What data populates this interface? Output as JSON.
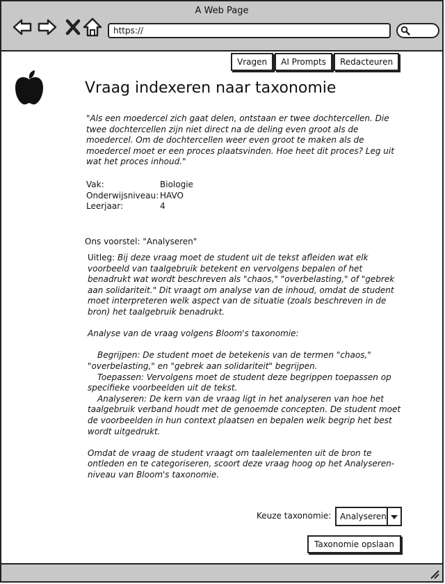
{
  "window": {
    "title": "A Web Page",
    "url": "https://"
  },
  "nav": {
    "tabs": [
      "Vragen",
      "AI Prompts",
      "Redacteuren"
    ]
  },
  "page": {
    "title": "Vraag indexeren naar taxonomie",
    "quote": "\"Als een moedercel zich gaat delen, ontstaan er twee dochtercellen. Die twee dochtercellen zijn niet direct na de deling even groot als de moedercel. Om de dochtercellen weer even groot te maken als de moedercel moet er een proces plaatsvinden. Hoe heet dit proces? Leg uit wat het proces inhoud.\"",
    "meta": [
      {
        "label": "Vak:",
        "value": "Biologie"
      },
      {
        "label": "Onderwijsniveau:",
        "value": "HAVO"
      },
      {
        "label": "Leerjaar:",
        "value": "4"
      }
    ],
    "proposal": "Ons voorstel: \"Analyseren\"",
    "explanation": {
      "uitleg_label": "Uitleg: ",
      "uitleg_text": "Bij deze vraag moet de student uit de tekst afleiden wat elk voorbeeld van taalgebruik betekent en vervolgens bepalen of het benadrukt wat wordt beschreven als \"chaos,\" \"overbelasting,\" of \"gebrek aan solidariteit.\" Dit vraagt om analyse van de inhoud, omdat de student moet interpreteren welk aspect van de situatie (zoals beschreven in de bron) het taalgebruik benadrukt.",
      "bloom_heading": "Analyse van de vraag volgens Bloom's taxonomie:",
      "begrijpen": "Begrijpen: De student moet de betekenis van de termen \"chaos,\" \"overbelasting,\" en \"gebrek aan solidariteit\" begrijpen.",
      "toepassen": "Toepassen: Vervolgens moet de student deze begrippen toepassen op specifieke voorbeelden uit de tekst.",
      "analyseren": "Analyseren: De kern van de vraag ligt in het analyseren van hoe het taalgebruik verband houdt met de genoemde concepten. De student moet de voorbeelden in hun context plaatsen en bepalen welk begrip het best wordt uitgedrukt.",
      "conclusion": "Omdat de vraag de student vraagt om taalelementen uit de bron te ontleden en te categoriseren, scoort deze vraag hoog op het Analyseren-niveau van Bloom's taxonomie."
    },
    "choice_label": "Keuze taxonomie:",
    "choice_value": "Analyseren",
    "save_label": "Taxonomie opslaan"
  }
}
